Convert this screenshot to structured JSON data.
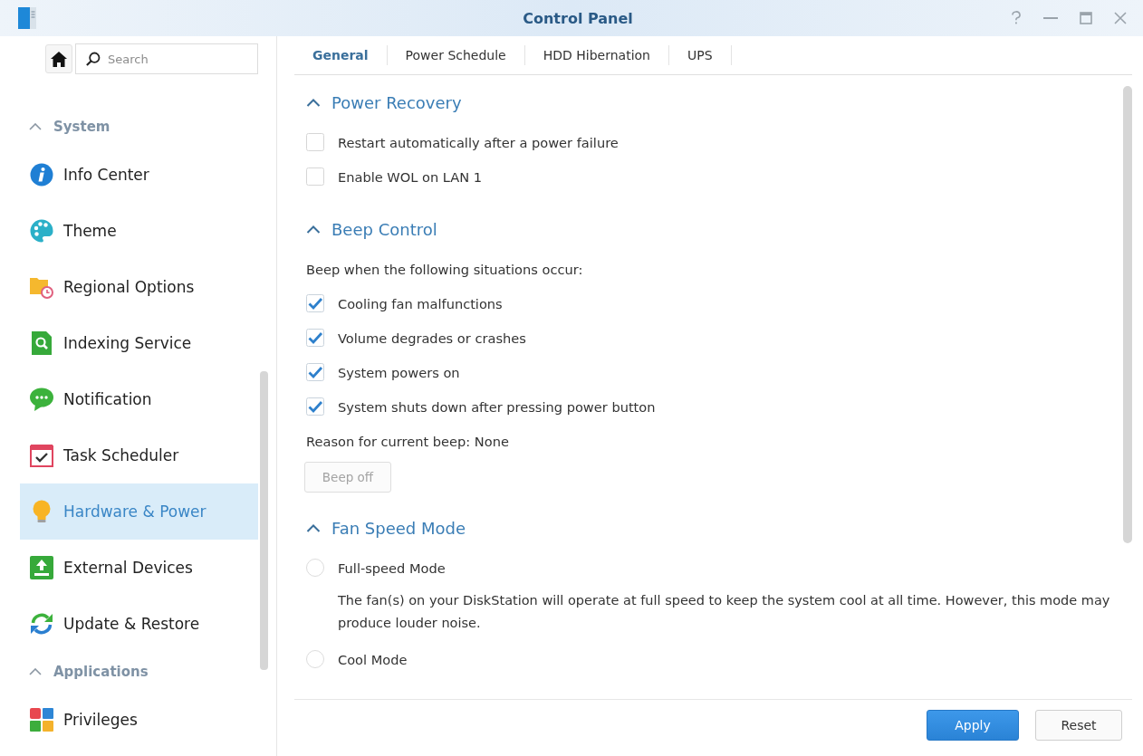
{
  "window": {
    "title": "Control Panel"
  },
  "sidebar": {
    "search": {
      "placeholder": "Search"
    },
    "groups": [
      {
        "label": "System",
        "expanded": true,
        "items": [
          {
            "label": "Info Center",
            "selected": false
          },
          {
            "label": "Theme",
            "selected": false
          },
          {
            "label": "Regional Options",
            "selected": false
          },
          {
            "label": "Indexing Service",
            "selected": false
          },
          {
            "label": "Notification",
            "selected": false
          },
          {
            "label": "Task Scheduler",
            "selected": false
          },
          {
            "label": "Hardware & Power",
            "selected": true
          },
          {
            "label": "External Devices",
            "selected": false
          },
          {
            "label": "Update & Restore",
            "selected": false
          }
        ]
      },
      {
        "label": "Applications",
        "expanded": true,
        "items": [
          {
            "label": "Privileges",
            "selected": false
          }
        ]
      }
    ]
  },
  "tabs": [
    {
      "label": "General",
      "selected": true
    },
    {
      "label": "Power Schedule",
      "selected": false
    },
    {
      "label": "HDD Hibernation",
      "selected": false
    },
    {
      "label": "UPS",
      "selected": false
    }
  ],
  "sections": [
    {
      "title": "Power Recovery",
      "expanded": true,
      "items": [
        {
          "kind": "checkbox",
          "label": "Restart automatically after a power failure",
          "checked": false
        },
        {
          "kind": "checkbox",
          "label": "Enable WOL on LAN 1",
          "checked": false
        }
      ]
    },
    {
      "title": "Beep Control",
      "expanded": true,
      "items": [
        {
          "kind": "text",
          "text": "Beep when the following situations occur:"
        },
        {
          "kind": "checkbox",
          "label": "Cooling fan malfunctions",
          "checked": true
        },
        {
          "kind": "checkbox",
          "label": "Volume degrades or crashes",
          "checked": true
        },
        {
          "kind": "checkbox",
          "label": "System powers on",
          "checked": true
        },
        {
          "kind": "checkbox",
          "label": "System shuts down after pressing power button",
          "checked": true
        },
        {
          "kind": "text",
          "text": "Reason for current beep: None"
        },
        {
          "kind": "button",
          "label": "Beep off",
          "disabled": true
        }
      ]
    },
    {
      "title": "Fan Speed Mode",
      "expanded": true,
      "items": [
        {
          "kind": "radio",
          "label": "Full-speed Mode",
          "selected": false
        },
        {
          "kind": "description",
          "text": "The fan(s) on your DiskStation will operate at full speed to keep the system cool at all time. However, this mode may produce louder noise."
        },
        {
          "kind": "radio",
          "label": "Cool Mode",
          "selected": false
        }
      ]
    }
  ],
  "footer": {
    "buttons": [
      {
        "label": "Apply",
        "kind": "primary"
      },
      {
        "label": "Reset",
        "kind": "secondary"
      }
    ]
  }
}
